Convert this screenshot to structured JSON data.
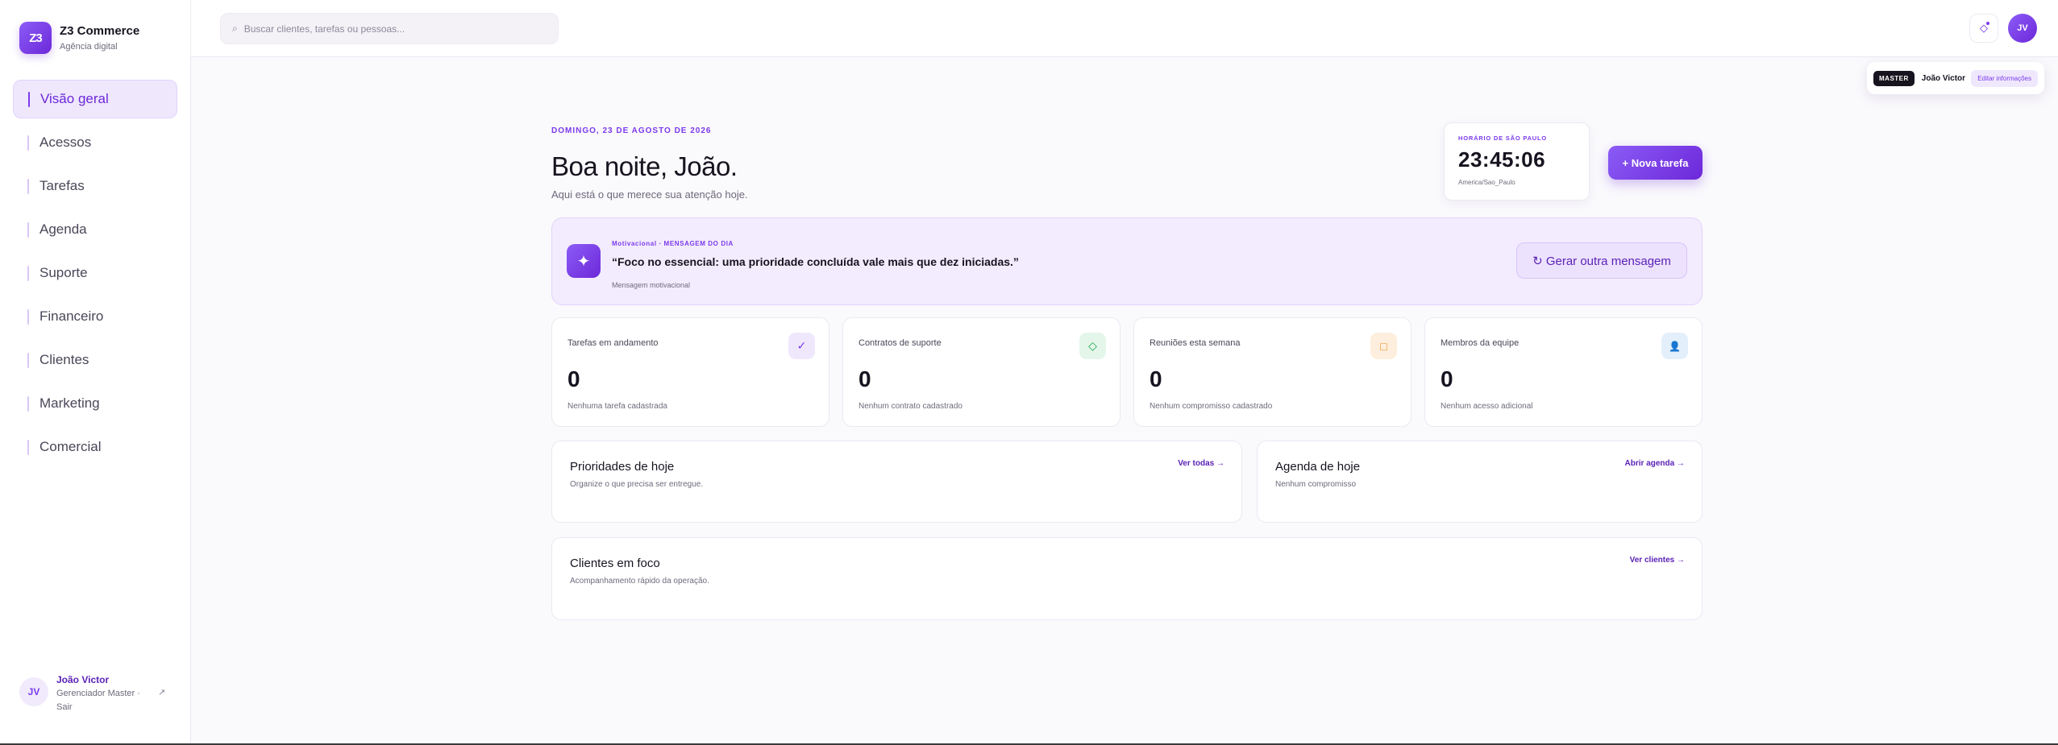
{
  "brand": {
    "logo": "Z3",
    "name": "Z3 Commerce",
    "subtitle": "Agência digital"
  },
  "nav": [
    {
      "label": "Visão geral",
      "active": true
    },
    {
      "label": "Acessos"
    },
    {
      "label": "Tarefas"
    },
    {
      "label": "Agenda"
    },
    {
      "label": "Suporte"
    },
    {
      "label": "Financeiro"
    },
    {
      "label": "Clientes"
    },
    {
      "label": "Marketing"
    },
    {
      "label": "Comercial"
    }
  ],
  "user": {
    "initials": "JV",
    "name": "João Victor",
    "role": "Gerenciador Master · Sair"
  },
  "search": {
    "placeholder": "Buscar clientes, tarefas ou pessoas...",
    "icon": "search-icon"
  },
  "topbar": {
    "notifications_icon": "diamond-icon",
    "avatar_initials": "JV"
  },
  "profile_popover": {
    "badge": "MASTER",
    "name": "João Victor",
    "edit_label": "Editar informações"
  },
  "header": {
    "date": "DOMINGO, 23 DE AGOSTO DE 2026",
    "greeting": "Boa noite, João.",
    "subtitle": "Aqui está o que merece sua atenção hoje."
  },
  "clock": {
    "label": "HORÁRIO DE SÃO PAULO",
    "time": "23:45:06",
    "timezone": "America/Sao_Paulo"
  },
  "new_task_label": "+ Nova tarefa",
  "motivation": {
    "icon": "sparkle-icon",
    "eyebrow": "Motivacional · MENSAGEM DO DIA",
    "quote": "“Foco no essencial: uma prioridade concluída vale mais que dez iniciadas.”",
    "caption": "Mensagem motivacional",
    "button_label": "↻ Gerar outra mensagem"
  },
  "stats": [
    {
      "label": "Tarefas em andamento",
      "value": "0",
      "note": "Nenhuma tarefa cadastrada",
      "icon": "check-icon",
      "color": "#7c3aed",
      "bg": "#efe8fd",
      "glyph": "✓"
    },
    {
      "label": "Contratos de suporte",
      "value": "0",
      "note": "Nenhum contrato cadastrado",
      "icon": "diamond-icon",
      "color": "#16a34a",
      "bg": "#e4f6ea",
      "glyph": "◇"
    },
    {
      "label": "Reuniões esta semana",
      "value": "0",
      "note": "Nenhum compromisso cadastrado",
      "icon": "calendar-icon",
      "color": "#ea8a1a",
      "bg": "#fdeedd",
      "glyph": "□"
    },
    {
      "label": "Membros da equipe",
      "value": "0",
      "note": "Nenhum acesso adicional",
      "icon": "person-icon",
      "color": "#2b7bd8",
      "bg": "#e3effb",
      "glyph": "👤"
    }
  ],
  "panels": {
    "priorities": {
      "title": "Prioridades de hoje",
      "subtitle": "Organize o que precisa ser entregue.",
      "link": "Ver todas →"
    },
    "agenda": {
      "title": "Agenda de hoje",
      "subtitle": "Nenhum compromisso",
      "link": "Abrir agenda →"
    },
    "clients": {
      "title": "Clientes em foco",
      "subtitle": "Acompanhamento rápido da operação.",
      "link": "Ver clientes →"
    }
  }
}
